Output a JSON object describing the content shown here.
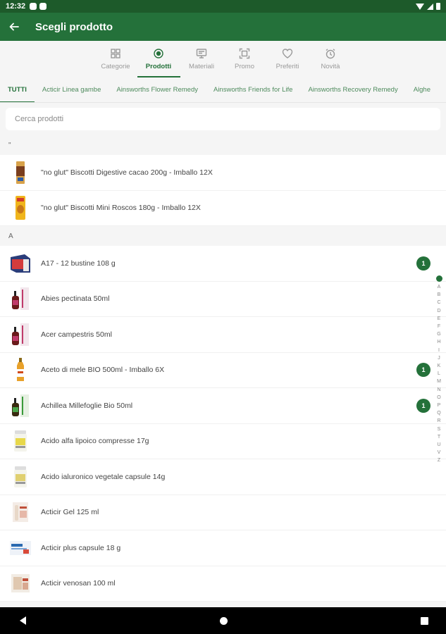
{
  "status_bar": {
    "time": "12:32"
  },
  "app_bar": {
    "title": "Scegli prodotto"
  },
  "tabs": [
    {
      "label": "Categorie",
      "icon": "grid-icon",
      "active": false
    },
    {
      "label": "Prodotti",
      "icon": "target-icon",
      "active": true
    },
    {
      "label": "Materiali",
      "icon": "monitor-icon",
      "active": false
    },
    {
      "label": "Promo",
      "icon": "scan-icon",
      "active": false
    },
    {
      "label": "Preferiti",
      "icon": "heart-icon",
      "active": false
    },
    {
      "label": "Novità",
      "icon": "alarm-clock-icon",
      "active": false
    }
  ],
  "categories": [
    "TUTTI",
    "Acticir Linea gambe",
    "Ainsworths Flower Remedy",
    "Ainsworths Friends for Life",
    "Ainsworths Recovery Remedy",
    "Alghe"
  ],
  "search": {
    "placeholder": "Cerca prodotti"
  },
  "sections": [
    {
      "header": "\"",
      "items": [
        {
          "name": "\"no glut\" Biscotti  Digestive cacao 200g - Imballo 12X",
          "thumb": "biscotti-box",
          "badge": ""
        },
        {
          "name": "\"no glut\" Biscotti  Mini Roscos 180g - Imballo 12X",
          "thumb": "biscotti-bag",
          "badge": ""
        }
      ]
    },
    {
      "header": "A",
      "items": [
        {
          "name": "A17 - 12 bustine 108 g",
          "thumb": "sachet-box",
          "badge": "1"
        },
        {
          "name": "Abies pectinata 50ml",
          "thumb": "dropper-bottle",
          "badge": ""
        },
        {
          "name": "Acer campestris 50ml",
          "thumb": "dropper-bottle",
          "badge": ""
        },
        {
          "name": "Aceto di mele BIO 500ml - Imballo 6X",
          "thumb": "vinegar-bottle",
          "badge": "1"
        },
        {
          "name": "Achillea Millefoglie Bio 50ml",
          "thumb": "dropper-bottle-green",
          "badge": "1"
        },
        {
          "name": "Acido alfa lipoico compresse 17g",
          "thumb": "supplement-jar",
          "badge": ""
        },
        {
          "name": "Acido ialuronico vegetale capsule 14g",
          "thumb": "supplement-jar",
          "badge": ""
        },
        {
          "name": "Acticir Gel 125 ml",
          "thumb": "gel-box",
          "badge": ""
        },
        {
          "name": "Acticir plus capsule 18 g",
          "thumb": "capsule-box",
          "badge": ""
        },
        {
          "name": "Acticir venosan 100 ml",
          "thumb": "venosan-box",
          "badge": ""
        }
      ]
    }
  ],
  "alpha_index": [
    "A",
    "B",
    "C",
    "D",
    "E",
    "F",
    "G",
    "H",
    "I",
    "J",
    "K",
    "L",
    "M",
    "N",
    "O",
    "P",
    "Q",
    "R",
    "S",
    "T",
    "U",
    "V",
    "Z"
  ],
  "colors": {
    "primary": "#24713a",
    "status_bar": "#1d5a2a",
    "badge": "#24713a"
  }
}
